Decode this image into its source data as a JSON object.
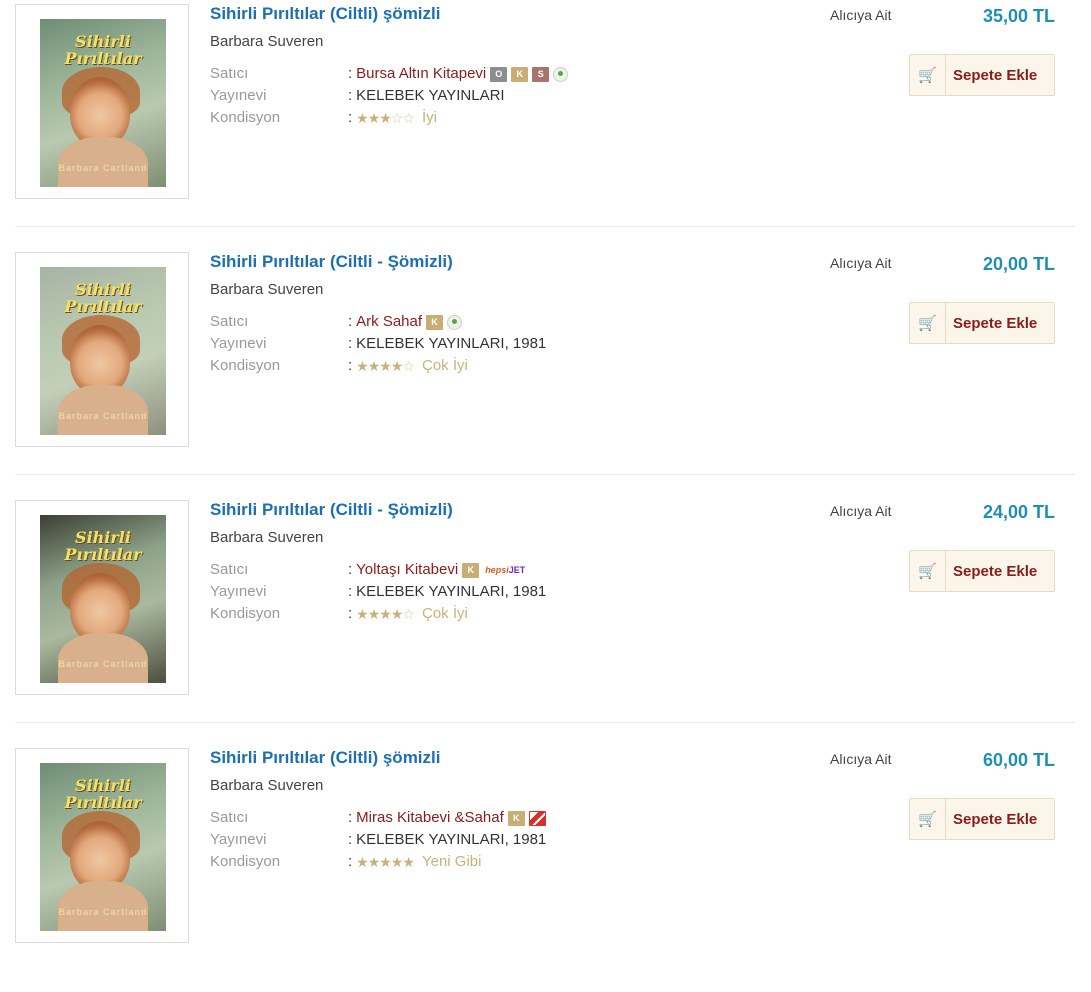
{
  "labels": {
    "seller": "Satıcı",
    "publisher": "Yayınevi",
    "condition": "Kondisyon",
    "shipping": "Alıcıya Ait",
    "add_to_cart": "Sepete Ekle"
  },
  "items": [
    {
      "title": "Sihirli Pırıltılar (Ciltli) şömizli",
      "author": "Barbara Suveren",
      "seller": "Bursa Altın Kitapevi",
      "publisher": "KELEBEK YAYINLARI",
      "condition": "İyi",
      "stars": 3,
      "price": "35,00 TL",
      "badges": [
        "gray",
        "k",
        "s",
        "loc"
      ],
      "cover_title": "Sihirli Pırıltılar",
      "cover_author": "Barbara Cartland"
    },
    {
      "title": "Sihirli Pırıltılar (Ciltli - Şömizli)",
      "author": "Barbara Suveren",
      "seller": "Ark Sahaf",
      "publisher": "KELEBEK YAYINLARI, 1981",
      "condition": "Çok İyi",
      "stars": 4,
      "price": "20,00 TL",
      "badges": [
        "k",
        "loc"
      ],
      "cover_title": "Sihirli Pırıltılar",
      "cover_author": "Barbara Cartland"
    },
    {
      "title": "Sihirli Pırıltılar (Ciltli - Şömizli)",
      "author": "Barbara Suveren",
      "seller": "Yoltaşı Kitabevi",
      "publisher": "KELEBEK YAYINLARI, 1981",
      "condition": "Çok İyi",
      "stars": 4,
      "price": "24,00 TL",
      "badges": [
        "k",
        "jet"
      ],
      "jet_text_a": "hepsi",
      "jet_text_b": "JET",
      "cover_title": "Sihirli Pırıltılar",
      "cover_author": "Barbara Cartland"
    },
    {
      "title": "Sihirli Pırıltılar (Ciltli) şömizli",
      "author": "Barbara Suveren",
      "seller": "Miras Kitabevi &Sahaf",
      "publisher": "KELEBEK YAYINLARI, 1981",
      "condition": "Yeni Gibi",
      "stars": 5,
      "price": "60,00 TL",
      "badges": [
        "k",
        "red"
      ],
      "cover_title": "Sihirli Pırıltılar",
      "cover_author": "Barbara Cartland"
    }
  ],
  "badge_letters": {
    "gray": "O",
    "k": "K",
    "s": "S"
  },
  "colors": {
    "title": "#1d6fb3",
    "price": "#1f8fb4",
    "seller": "#8a1c1c",
    "condition": "#c8b27a"
  }
}
